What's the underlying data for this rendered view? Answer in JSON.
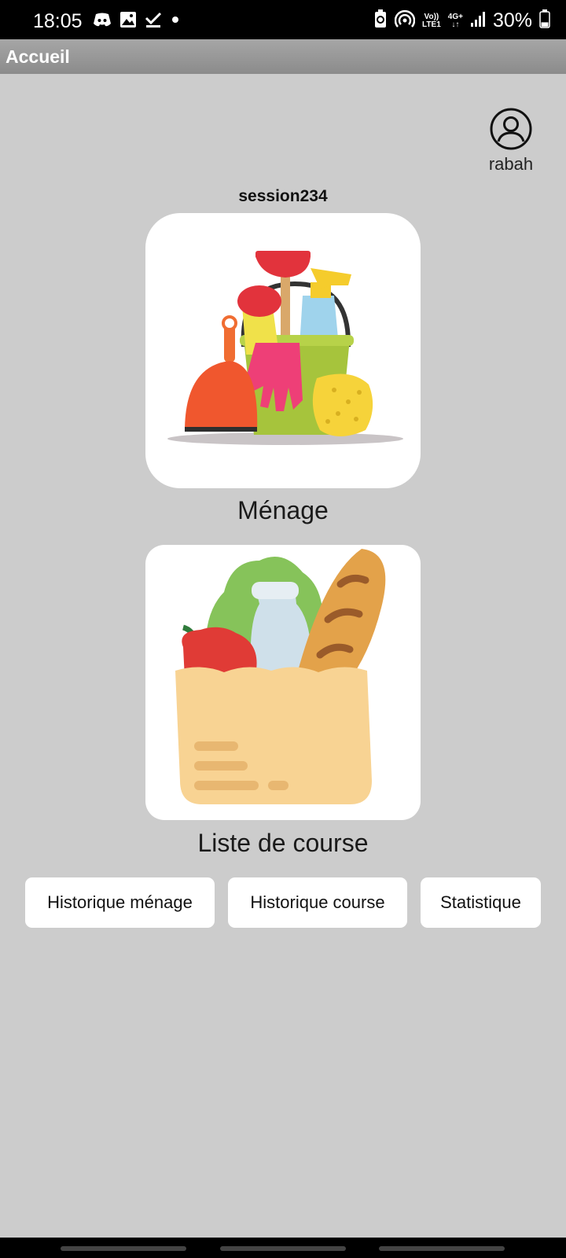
{
  "status_bar": {
    "time": "18:05",
    "left_icons": [
      "discord-icon",
      "image-icon",
      "checkmark-icon",
      "dot-icon"
    ],
    "right_icons": [
      "battery-saver-icon",
      "hotspot-icon",
      "volte-icon",
      "4g-icon",
      "signal-icon",
      "battery-icon"
    ],
    "volte_label_top": "Vo))",
    "volte_label_bottom": "LTE1",
    "network_label_top": "4G+",
    "network_label_bottom": "↓↑",
    "battery_percent": "30%",
    "battery_level": 0.3
  },
  "app_bar": {
    "title": "Accueil"
  },
  "profile": {
    "username": "rabah"
  },
  "session": {
    "name": "session234"
  },
  "cards": {
    "menage": {
      "label": "Ménage",
      "image_icon": "cleaning-supplies-icon"
    },
    "course": {
      "label": "Liste de course",
      "image_icon": "grocery-bag-icon"
    }
  },
  "buttons": {
    "historique_menage": "Historique ménage",
    "historique_course": "Historique course",
    "statistique": "Statistique"
  },
  "colors": {
    "background": "#cccccc",
    "app_bar": "#999999",
    "card": "#ffffff"
  }
}
